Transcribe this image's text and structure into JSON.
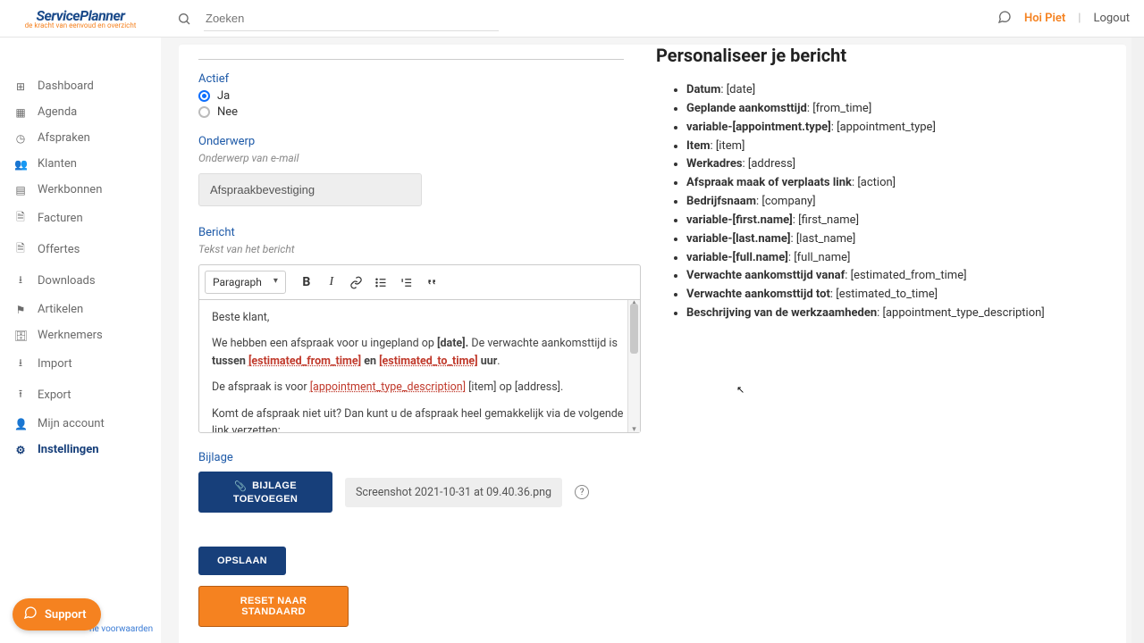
{
  "brand": {
    "name": "ServicePlanner",
    "tagline": "de kracht van eenvoud en overzicht"
  },
  "topbar": {
    "search_placeholder": "Zoeken",
    "greeting": "Hoi Piet",
    "logout": "Logout"
  },
  "sidebar": {
    "items": [
      {
        "icon": "⊞",
        "label": "Dashboard"
      },
      {
        "icon": "▦",
        "label": "Agenda"
      },
      {
        "icon": "◷",
        "label": "Afspraken"
      },
      {
        "icon": "👥",
        "label": "Klanten"
      },
      {
        "icon": "▤",
        "label": "Werkbonnen"
      },
      {
        "icon": "🗎",
        "label": "Facturen"
      },
      {
        "icon": "🗎",
        "label": "Offertes"
      },
      {
        "icon": "⭳",
        "label": "Downloads"
      },
      {
        "icon": "⚑",
        "label": "Artikelen"
      },
      {
        "icon": "🗄",
        "label": "Werknemers"
      },
      {
        "icon": "⭳",
        "label": "Import"
      },
      {
        "icon": "⭱",
        "label": "Export"
      },
      {
        "icon": "👤",
        "label": "Mijn account"
      },
      {
        "icon": "⚙",
        "label": "Instellingen"
      }
    ],
    "active_index": 13,
    "terms": "ne voorwaarden"
  },
  "form": {
    "actief_label": "Actief",
    "actief_yes": "Ja",
    "actief_no": "Nee",
    "onderwerp_label": "Onderwerp",
    "onderwerp_hint": "Onderwerp van e-mail",
    "onderwerp_value": "Afspraakbevestiging",
    "bericht_label": "Bericht",
    "bericht_hint": "Tekst van het bericht",
    "editor_paragraph": "Paragraph",
    "editor": {
      "greeting": "Beste klant,",
      "line2a": "We hebben een afspraak voor u ingepland op ",
      "line2_date": "[date].",
      "line2b": " De verwachte aankomsttijd is ",
      "line2_between": "tussen ",
      "line2_from": "[estimated_from_time]",
      "line2_and": " en ",
      "line2_to": "[estimated_to_time]",
      "line2_hour": " uur",
      "line3a": "De afspraak is voor ",
      "line3_type": "[appointment_type_description]",
      "line3b": " [item] op [address].",
      "line4": "Komt de afspraak niet uit? Dan kunt u de afspraak heel gemakkelijk via de volgende link verzetten:"
    },
    "bijlage_label": "Bijlage",
    "attach_btn_top": "BIJLAGE",
    "attach_btn_bottom": "TOEVOEGEN",
    "attached_file": "Screenshot 2021-10-31 at 09.40.36.png",
    "save_btn": "OPSLAAN",
    "reset_btn": "RESET NAAR STANDAARD"
  },
  "vars_panel": {
    "title": "Personaliseer je bericht",
    "items": [
      {
        "label": "Datum",
        "token": "[date]"
      },
      {
        "label": "Geplande aankomsttijd",
        "token": "[from_time]"
      },
      {
        "label": "variable-[appointment.type]",
        "token": "[appointment_type]"
      },
      {
        "label": "Item",
        "token": "[item]"
      },
      {
        "label": "Werkadres",
        "token": "[address]"
      },
      {
        "label": "Afspraak maak of verplaats link",
        "token": "[action]"
      },
      {
        "label": "Bedrijfsnaam",
        "token": "[company]"
      },
      {
        "label": "variable-[first.name]",
        "token": "[first_name]"
      },
      {
        "label": "variable-[last.name]",
        "token": "[last_name]"
      },
      {
        "label": "variable-[full.name]",
        "token": "[full_name]"
      },
      {
        "label": "Verwachte aankomsttijd vanaf",
        "token": "[estimated_from_time]"
      },
      {
        "label": "Verwachte aankomsttijd tot",
        "token": "[estimated_to_time]"
      },
      {
        "label": "Beschrijving van de werkzaamheden",
        "token": "[appointment_type_description]"
      }
    ]
  },
  "support_label": "Support"
}
